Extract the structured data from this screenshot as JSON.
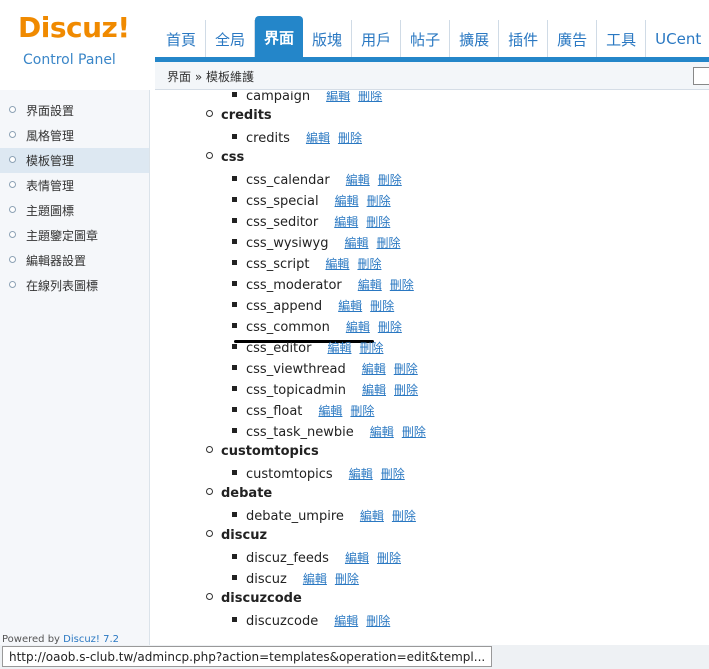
{
  "logo": {
    "brand": "Discuz",
    "bang": "!",
    "subtitle": "Control Panel"
  },
  "nav": {
    "items": [
      "首頁",
      "全局",
      "界面",
      "版塊",
      "用戶",
      "帖子",
      "擴展",
      "插件",
      "廣告",
      "工具",
      "UCent"
    ],
    "active": "界面"
  },
  "breadcrumb": "界面 » 模板維護",
  "sidebar": {
    "items": [
      "界面設置",
      "風格管理",
      "模板管理",
      "表情管理",
      "主題圖標",
      "主題鑒定圖章",
      "編輯器設置",
      "在線列表圖標"
    ],
    "active": "模板管理",
    "powered_prefix": "Powered by ",
    "powered_brand": "Discuz! 7.2"
  },
  "actions": {
    "edit": "編輯",
    "delete": "刪除"
  },
  "templates": {
    "partial_top": "campaign",
    "groups": [
      {
        "name": "credits",
        "files": [
          "credits"
        ]
      },
      {
        "name": "css",
        "files": [
          "css_calendar",
          "css_special",
          "css_seditor",
          "css_wysiwyg",
          "css_script",
          "css_moderator",
          "css_append",
          "css_common",
          "css_editor",
          "css_viewthread",
          "css_topicadmin",
          "css_float",
          "css_task_newbie"
        ]
      },
      {
        "name": "customtopics",
        "files": [
          "customtopics"
        ]
      },
      {
        "name": "debate",
        "files": [
          "debate_umpire"
        ]
      },
      {
        "name": "discuz",
        "files": [
          "discuz_feeds",
          "discuz"
        ]
      },
      {
        "name": "discuzcode",
        "files": [
          "discuzcode"
        ]
      }
    ]
  },
  "status_url": "http://oaob.s-club.tw/admincp.php?action=templates&operation=edit&templ..."
}
